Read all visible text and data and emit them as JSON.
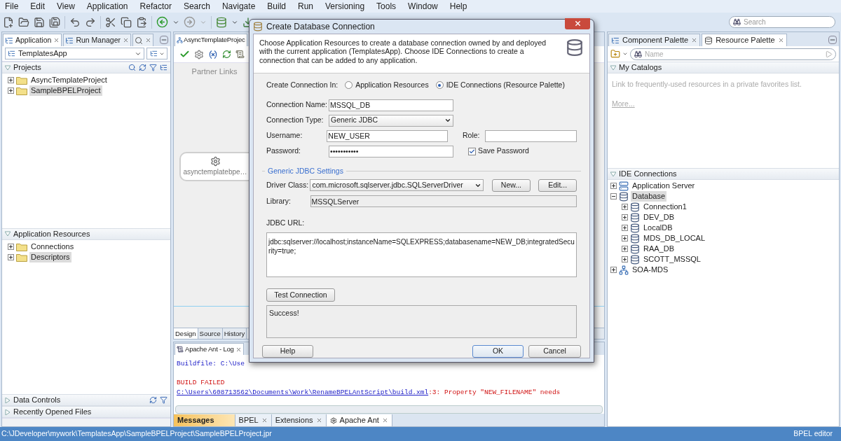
{
  "menu": [
    "File",
    "Edit",
    "View",
    "Application",
    "Refactor",
    "Search",
    "Navigate",
    "Build",
    "Run",
    "Versioning",
    "Tools",
    "Window",
    "Help"
  ],
  "search": {
    "placeholder": "Search"
  },
  "left_panel": {
    "tabs": [
      {
        "kind": "text",
        "label": "Application",
        "selected": true
      },
      {
        "kind": "text",
        "label": "Run Manager",
        "selected": false
      },
      {
        "kind": "icon",
        "selected": false
      }
    ],
    "application_selector": "TemplatesApp",
    "projects": {
      "title": "Projects",
      "items": [
        {
          "label": "AsyncTemplateProject",
          "expanded": false,
          "selected": false
        },
        {
          "label": "SampleBPELProject",
          "expanded": false,
          "selected": true
        }
      ]
    },
    "application_resources": {
      "title": "Application Resources",
      "items": [
        {
          "label": "Connections",
          "expanded": false,
          "selected": false
        },
        {
          "label": "Descriptors",
          "expanded": false,
          "selected": true
        }
      ]
    },
    "collapsed_sections": [
      "Data Controls",
      "Recently Opened Files"
    ]
  },
  "editor": {
    "tab": "AsyncTemplateProjec",
    "lane_label": "Partner Links",
    "node_label": "asynctemplatebpe…",
    "view_tabs": [
      {
        "label": "Design",
        "selected": true
      },
      {
        "label": "Source",
        "selected": false
      },
      {
        "label": "History",
        "selected": false
      }
    ]
  },
  "log": {
    "tab": "Apache Ant - Log",
    "lines": [
      {
        "kind": "info",
        "text": "Buildfile: C:\\Use"
      },
      {
        "kind": "error",
        "text": "BUILD FAILED"
      },
      {
        "kind": "error_link",
        "link": "C:\\Users\\608713562\\Documents\\Work\\RenameBPELAntScript\\build.xml",
        "text": ":3: Property \"NEW_FILENAME\" needs"
      }
    ],
    "tabs": [
      {
        "label": "Messages",
        "selected": false,
        "attention": true,
        "closable": false
      },
      {
        "label": "BPEL",
        "selected": false,
        "attention": false,
        "closable": true
      },
      {
        "label": "Extensions",
        "selected": false,
        "attention": false,
        "closable": true
      },
      {
        "label": "Apache Ant",
        "selected": true,
        "attention": false,
        "closable": true
      }
    ]
  },
  "right_panel": {
    "tabs": [
      {
        "label": "Component Palette",
        "selected": false
      },
      {
        "label": "Resource Palette",
        "selected": true
      }
    ],
    "name_search": {
      "placeholder": "Name"
    },
    "my_catalogs": {
      "title": "My Catalogs",
      "hint": "Link to frequently-used resources in a private favorites list.",
      "link": "More..."
    },
    "ide_connections": {
      "title": "IDE Connections",
      "items": [
        {
          "kind": "server",
          "label": "Application Server",
          "expanded": false,
          "selected": false
        },
        {
          "kind": "database",
          "label": "Database",
          "expanded": true,
          "selected": true,
          "children": [
            {
              "kind": "database",
              "label": "Connection1",
              "expanded": false,
              "selected": false
            },
            {
              "kind": "database",
              "label": "DEV_DB",
              "expanded": false,
              "selected": false
            },
            {
              "kind": "database",
              "label": "LocalDB",
              "expanded": false,
              "selected": false
            },
            {
              "kind": "database",
              "label": "MDS_DB_LOCAL",
              "expanded": false,
              "selected": false
            },
            {
              "kind": "database",
              "label": "RAA_DB",
              "expanded": false,
              "selected": false
            },
            {
              "kind": "database",
              "label": "SCOTT_MSSQL",
              "expanded": false,
              "selected": false
            }
          ]
        },
        {
          "kind": "repository",
          "label": "SOA-MDS",
          "expanded": false,
          "selected": false
        }
      ]
    }
  },
  "dialog": {
    "title": "Create Database Connection",
    "description": "Choose Application Resources to create a database connection owned by and deployed with the current application (TemplatesApp). Choose IDE Connections to create a connection that can be added to any application.",
    "create_in_label": "Create Connection In:",
    "create_in_options": [
      {
        "label": "Application Resources",
        "selected": false
      },
      {
        "label": "IDE Connections (Resource Palette)",
        "selected": true
      }
    ],
    "connection_name": {
      "label": "Connection Name:",
      "value": "MSSQL_DB"
    },
    "connection_type": {
      "label": "Connection Type:",
      "value": "Generic JDBC"
    },
    "username": {
      "label": "Username:",
      "value": "NEW_USER"
    },
    "role": {
      "label": "Role:"
    },
    "password": {
      "label": "Password:",
      "value": "•••••••••••"
    },
    "save_password": {
      "label": "Save Password",
      "checked": true
    },
    "settings_title": "Generic JDBC Settings",
    "driver_class": {
      "label": "Driver Class:",
      "value": "com.microsoft.sqlserver.jdbc.SQLServerDriver"
    },
    "new_button": "New...",
    "edit_button": "Edit...",
    "library": {
      "label": "Library:",
      "value": "MSSQLServer"
    },
    "jdbc_url": {
      "label": "JDBC URL:",
      "value": "jdbc:sqlserver://localhost;instanceName=SQLEXPRESS;databasename=NEW_DB;integratedSecurity=true;"
    },
    "test_button": "Test Connection",
    "test_result": "Success!",
    "help_button": "Help",
    "ok_button": "OK",
    "cancel_button": "Cancel"
  },
  "status_bar": {
    "path": "C:\\JDeveloper\\mywork\\TemplatesApp\\SampleBPELProject\\SampleBPELProject.jpr",
    "mode": "BPEL editor"
  }
}
